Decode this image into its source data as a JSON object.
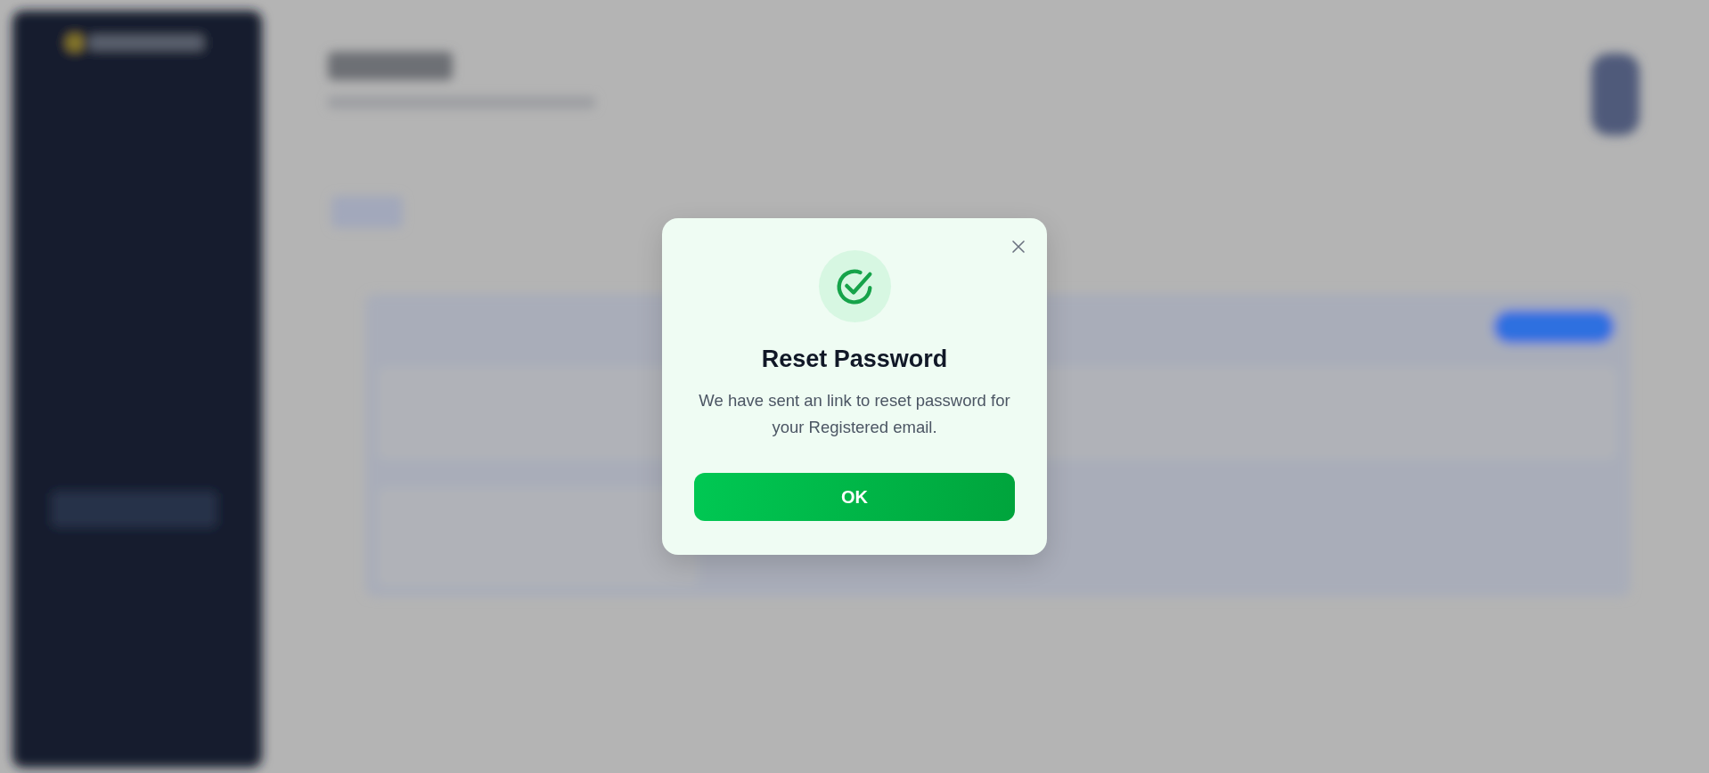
{
  "dialog": {
    "title": "Reset Password",
    "message": "We have sent an link to reset password for your Registered email.",
    "button": {
      "label": "OK"
    }
  }
}
